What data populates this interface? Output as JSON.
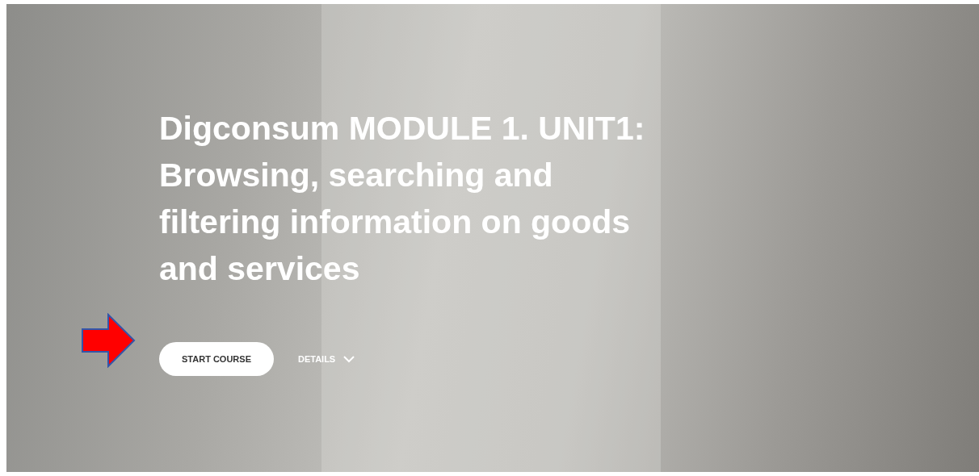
{
  "hero": {
    "title": "Digconsum MODULE 1. UNIT1: Browsing, searching and filtering information on goods and services",
    "buttons": [
      {
        "label": "START COURSE",
        "kind": "primary"
      },
      {
        "label": "DETAILS",
        "kind": "dropdown",
        "expanded": false
      }
    ]
  }
}
